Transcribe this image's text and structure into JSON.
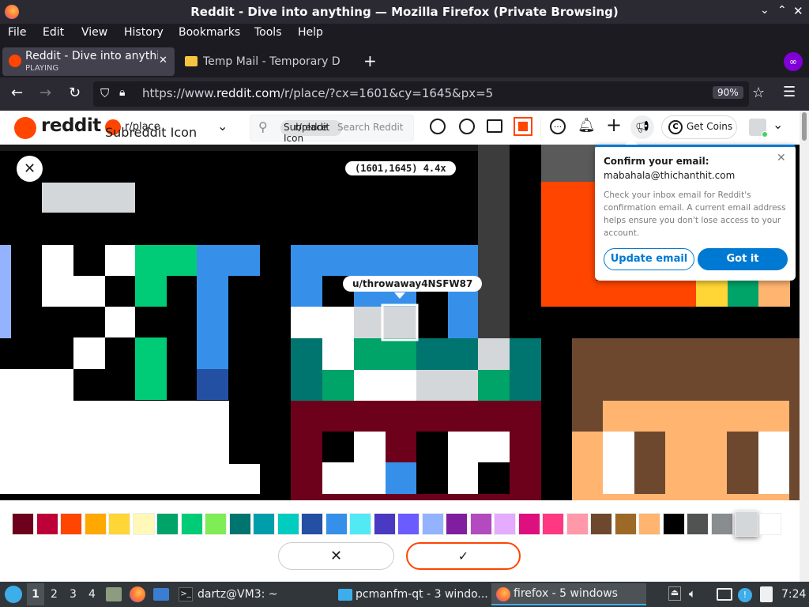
{
  "window": {
    "title": "Reddit - Dive into anything — Mozilla Firefox (Private Browsing)"
  },
  "menu": [
    "File",
    "Edit",
    "View",
    "History",
    "Bookmarks",
    "Tools",
    "Help"
  ],
  "tabs": [
    {
      "label": "Reddit - Dive into anythi",
      "sub": "PLAYING"
    },
    {
      "label": "Temp Mail - Temporary D"
    }
  ],
  "url": {
    "prefix": "https://www.",
    "domain": "reddit.com",
    "path": "/r/place/?cx=1601&cy=1645&px=5",
    "zoom": "90%"
  },
  "reddit_header": {
    "logo_text": "reddit",
    "community": "r/place",
    "community_alt": "Subreddit Icon",
    "search_placeholder": "Search Reddit",
    "search_chip": "r/place",
    "search_chip_alt": "Subreddit Icon",
    "get_coins": "Get Coins"
  },
  "place": {
    "coords": "(1601,1645) 4.4x",
    "user_tooltip": "u/throwaway4NSFW87"
  },
  "email_popup": {
    "title": "Confirm your email:",
    "email": "mabahala@thichanthit.com",
    "body": "Check your inbox email for Reddit's confirmation email. A current email address helps ensure you don't lose access to your account.",
    "update_btn": "Update email",
    "got_it_btn": "Got it"
  },
  "palette": [
    "#6d001a",
    "#be0039",
    "#ff4500",
    "#ffa800",
    "#ffd635",
    "#fff8b8",
    "#00a368",
    "#00cc78",
    "#7eed56",
    "#00756f",
    "#009eaa",
    "#00ccc0",
    "#2450a4",
    "#3690ea",
    "#51e9f4",
    "#493ac1",
    "#6a5cff",
    "#94b3ff",
    "#811e9f",
    "#b44ac0",
    "#e4abff",
    "#de107f",
    "#ff3881",
    "#ff99aa",
    "#6d482f",
    "#9c6926",
    "#ffb470",
    "#000000",
    "#515252",
    "#898d90",
    "#d4d7d9",
    "#ffffff"
  ],
  "taskbar": {
    "workspaces": [
      "1",
      "2",
      "3",
      "4"
    ],
    "terminal": "dartz@VM3: ~",
    "files": "pcmanfm-qt - 3 windo...",
    "firefox": "firefox - 5 windows",
    "clock": "7:24"
  },
  "colors": {
    "reddit_orange": "#ff4500",
    "reddit_blue": "#0079d3"
  }
}
